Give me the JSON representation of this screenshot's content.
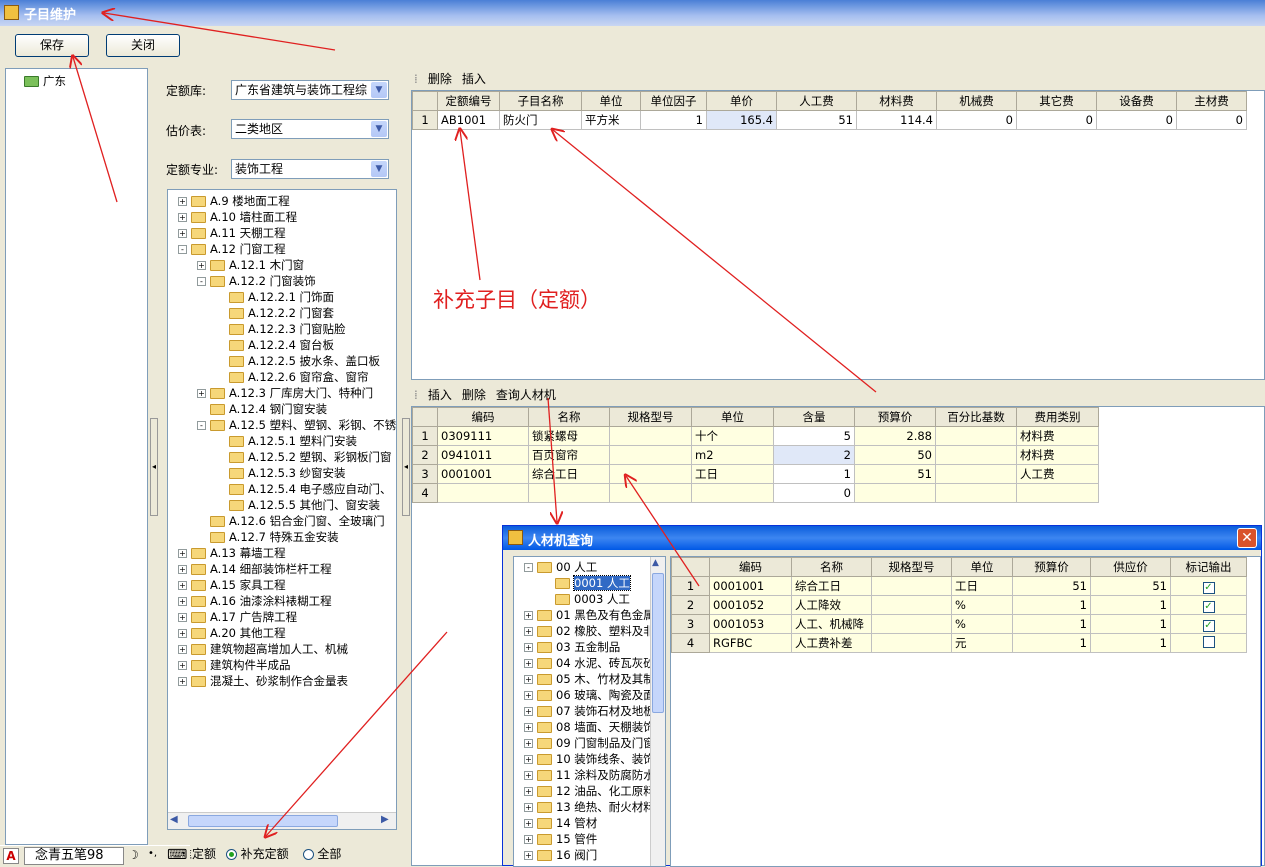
{
  "window": {
    "title": "子目维护"
  },
  "toolbar": {
    "save": "保存",
    "close": "关闭"
  },
  "region_tree": {
    "root": "广东"
  },
  "form": {
    "lib_label": "定额库:",
    "lib_value": "广东省建筑与装饰工程综",
    "price_label": "估价表:",
    "price_value": "二类地区",
    "major_label": "定额专业:",
    "major_value": "装饰工程"
  },
  "quota_tree": [
    {
      "label": "A.9 楼地面工程",
      "level": 0,
      "exp": "+"
    },
    {
      "label": "A.10 墙柱面工程",
      "level": 0,
      "exp": "+"
    },
    {
      "label": "A.11 天棚工程",
      "level": 0,
      "exp": "+"
    },
    {
      "label": "A.12 门窗工程",
      "level": 0,
      "exp": "-"
    },
    {
      "label": "A.12.1 木门窗",
      "level": 1,
      "exp": "+"
    },
    {
      "label": "A.12.2 门窗装饰",
      "level": 1,
      "exp": "-"
    },
    {
      "label": "A.12.2.1 门饰面",
      "level": 2,
      "exp": ""
    },
    {
      "label": "A.12.2.2 门窗套",
      "level": 2,
      "exp": ""
    },
    {
      "label": "A.12.2.3 门窗贴脸",
      "level": 2,
      "exp": ""
    },
    {
      "label": "A.12.2.4 窗台板",
      "level": 2,
      "exp": ""
    },
    {
      "label": "A.12.2.5 披水条、盖口板",
      "level": 2,
      "exp": ""
    },
    {
      "label": "A.12.2.6 窗帘盒、窗帘",
      "level": 2,
      "exp": ""
    },
    {
      "label": "A.12.3 厂库房大门、特种门",
      "level": 1,
      "exp": "+"
    },
    {
      "label": "A.12.4 钢门窗安装",
      "level": 1,
      "exp": ""
    },
    {
      "label": "A.12.5 塑料、塑钢、彩钢、不锈",
      "level": 1,
      "exp": "-"
    },
    {
      "label": "A.12.5.1 塑料门安装",
      "level": 2,
      "exp": ""
    },
    {
      "label": "A.12.5.2 塑钢、彩钢板门窗",
      "level": 2,
      "exp": ""
    },
    {
      "label": "A.12.5.3 纱窗安装",
      "level": 2,
      "exp": ""
    },
    {
      "label": "A.12.5.4 电子感应自动门、",
      "level": 2,
      "exp": ""
    },
    {
      "label": "A.12.5.5 其他门、窗安装",
      "level": 2,
      "exp": ""
    },
    {
      "label": "A.12.6 铝合金门窗、全玻璃门",
      "level": 1,
      "exp": ""
    },
    {
      "label": "A.12.7 特殊五金安装",
      "level": 1,
      "exp": ""
    },
    {
      "label": "A.13 幕墙工程",
      "level": 0,
      "exp": "+"
    },
    {
      "label": "A.14 细部装饰栏杆工程",
      "level": 0,
      "exp": "+"
    },
    {
      "label": "A.15 家具工程",
      "level": 0,
      "exp": "+"
    },
    {
      "label": "A.16 油漆涂料裱糊工程",
      "level": 0,
      "exp": "+"
    },
    {
      "label": "A.17 广告牌工程",
      "level": 0,
      "exp": "+"
    },
    {
      "label": "A.20 其他工程",
      "level": 0,
      "exp": "+"
    },
    {
      "label": "建筑物超高增加人工、机械",
      "level": 0,
      "exp": "+"
    },
    {
      "label": "建筑构件半成品",
      "level": 0,
      "exp": "+"
    },
    {
      "label": "混凝土、砂浆制作合金量表",
      "level": 0,
      "exp": "+"
    }
  ],
  "radios": {
    "standard": "标准定额",
    "supplement": "补充定额",
    "all": "全部"
  },
  "upper_toolbar": {
    "delete": "删除",
    "insert": "插入"
  },
  "upper_grid": {
    "headers": [
      "定额编号",
      "子目名称",
      "单位",
      "单位因子",
      "单价",
      "人工费",
      "材料费",
      "机械费",
      "其它费",
      "设备费",
      "主材费"
    ],
    "rows": [
      [
        "1",
        "AB1001",
        "防火门",
        "平方米",
        "1",
        "165.4",
        "51",
        "114.4",
        "0",
        "0",
        "0",
        "0"
      ]
    ]
  },
  "annotation": "补充子目（定额）",
  "lower_toolbar": {
    "insert": "插入",
    "delete": "删除",
    "query": "查询人材机"
  },
  "lower_grid": {
    "headers": [
      "编码",
      "名称",
      "规格型号",
      "单位",
      "含量",
      "预算价",
      "百分比基数",
      "费用类别"
    ],
    "rows": [
      [
        "1",
        "0309111",
        "锁紧螺母",
        "",
        "十个",
        "5",
        "2.88",
        "",
        "材料费"
      ],
      [
        "2",
        "0941011",
        "百页窗帘",
        "",
        "m2",
        "2",
        "50",
        "",
        "材料费"
      ],
      [
        "3",
        "0001001",
        "综合工日",
        "",
        "工日",
        "1",
        "51",
        "",
        "人工费"
      ],
      [
        "4",
        "",
        "",
        "",
        "",
        "0",
        "",
        "",
        ""
      ]
    ]
  },
  "dialog": {
    "title": "人材机查询",
    "close": "✕",
    "tree": [
      {
        "label": "00 人工",
        "level": 0,
        "exp": "-"
      },
      {
        "label": "0001 人工",
        "level": 1,
        "exp": "",
        "selected": true
      },
      {
        "label": "0003 人工",
        "level": 1,
        "exp": ""
      },
      {
        "label": "01 黑色及有色金属",
        "level": 0,
        "exp": "+"
      },
      {
        "label": "02 橡胶、塑料及非",
        "level": 0,
        "exp": "+"
      },
      {
        "label": "03 五金制品",
        "level": 0,
        "exp": "+"
      },
      {
        "label": "04 水泥、砖瓦灰砂",
        "level": 0,
        "exp": "+"
      },
      {
        "label": "05 木、竹材及其制",
        "level": 0,
        "exp": "+"
      },
      {
        "label": "06 玻璃、陶瓷及面",
        "level": 0,
        "exp": "+"
      },
      {
        "label": "07 装饰石材及地板",
        "level": 0,
        "exp": "+"
      },
      {
        "label": "08 墙面、天棚装饰",
        "level": 0,
        "exp": "+"
      },
      {
        "label": "09 门窗制品及门窗",
        "level": 0,
        "exp": "+"
      },
      {
        "label": "10 装饰线条、装饰",
        "level": 0,
        "exp": "+"
      },
      {
        "label": "11 涂料及防腐防水",
        "level": 0,
        "exp": "+"
      },
      {
        "label": "12 油品、化工原料",
        "level": 0,
        "exp": "+"
      },
      {
        "label": "13 绝热、耐火材料",
        "level": 0,
        "exp": "+"
      },
      {
        "label": "14 管材",
        "level": 0,
        "exp": "+"
      },
      {
        "label": "15 管件",
        "level": 0,
        "exp": "+"
      },
      {
        "label": "16 阀门",
        "level": 0,
        "exp": "+"
      }
    ],
    "grid_headers": [
      "编码",
      "名称",
      "规格型号",
      "单位",
      "预算价",
      "供应价",
      "标记输出"
    ],
    "grid_rows": [
      [
        "1",
        "0001001",
        "综合工日",
        "",
        "工日",
        "51",
        "51",
        true
      ],
      [
        "2",
        "0001052",
        "人工降效",
        "",
        "%",
        "1",
        "1",
        true
      ],
      [
        "3",
        "0001053",
        "人工、机械降",
        "",
        "%",
        "1",
        "1",
        true
      ],
      [
        "4",
        "RGFBC",
        "人工费补差",
        "",
        "元",
        "1",
        "1",
        false
      ]
    ]
  },
  "ime": {
    "letter": "A",
    "name": "念青五笔98",
    "moon": "☽",
    "punct": "•,",
    "kb": "⌨"
  },
  "colors": {
    "title_bar": "#4a7fd6",
    "header_highlight": "#f8c850",
    "annotation": "#e02020",
    "dialog_title": "#0a5ddb"
  }
}
